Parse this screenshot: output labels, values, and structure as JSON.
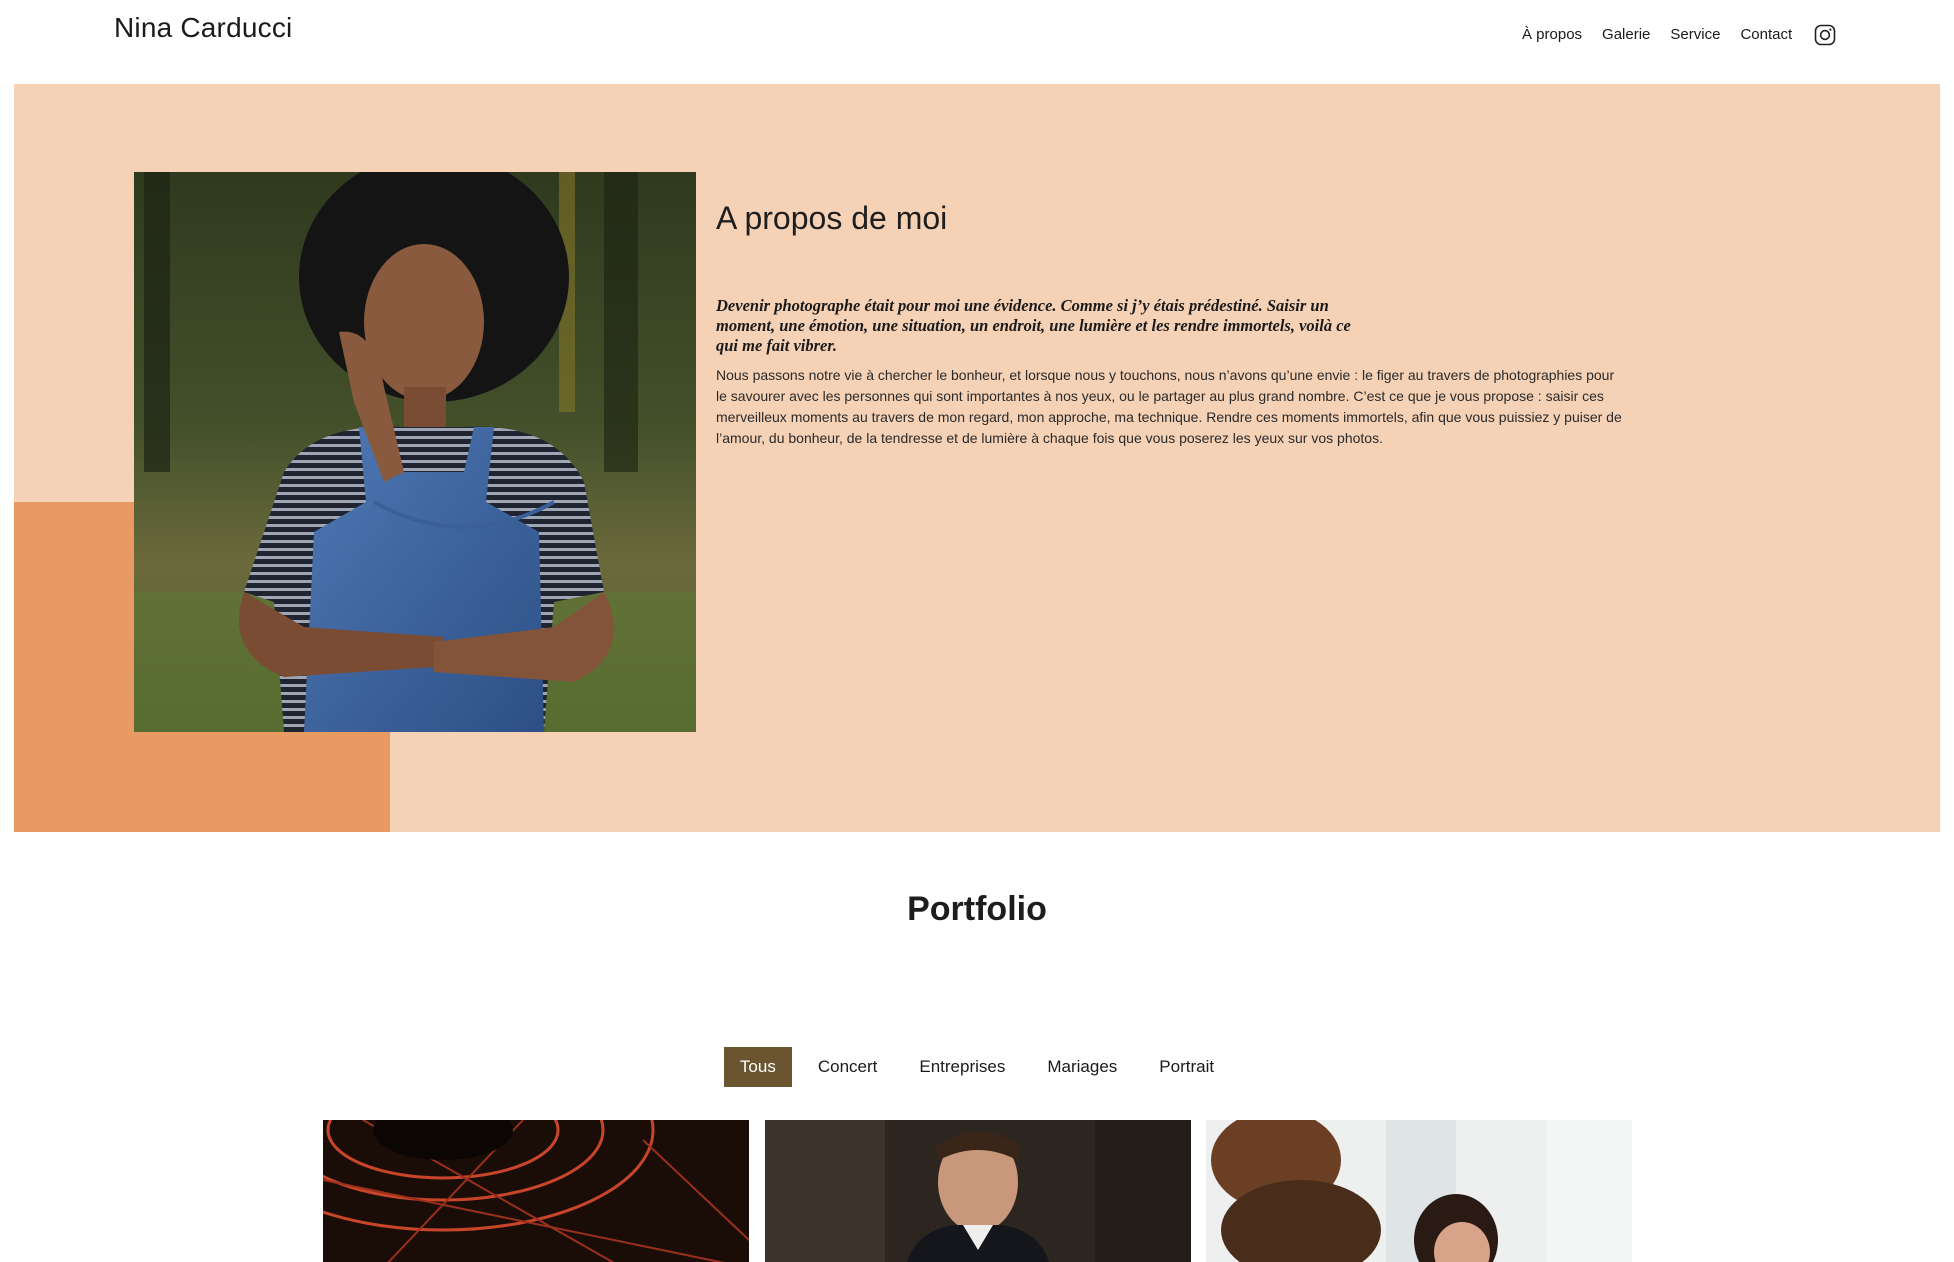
{
  "header": {
    "brand": "Nina Carducci",
    "nav": [
      {
        "label": "À propos"
      },
      {
        "label": "Galerie"
      },
      {
        "label": "Service"
      },
      {
        "label": "Contact"
      }
    ],
    "social_icon": "instagram-icon"
  },
  "about": {
    "title": "A propos de moi",
    "quote": "Devenir photographe était pour moi une évidence. Comme si j’y étais prédestiné. Saisir un moment, une émotion, une situation, un endroit, une lumière et les rendre immortels, voilà ce qui me fait vibrer.",
    "text": "Nous passons notre vie à chercher le bonheur, et lorsque nous y touchons, nous n’avons qu’une envie : le figer au travers de photographies pour le savourer avec les personnes qui sont importantes à nos yeux, ou le partager au plus grand nombre. C’est ce que je vous propose : saisir ces merveilleux moments au travers de mon regard, mon approche, ma technique. Rendre ces moments immortels, afin que vous puissiez y puiser de l’amour, du bonheur, de la tendresse et de lumière à chaque fois que vous poserez les yeux sur vos photos.",
    "colors": {
      "background": "#f5d1b6",
      "accent": "#e79b62"
    }
  },
  "portfolio": {
    "title": "Portfolio",
    "filters": [
      {
        "label": "Tous",
        "active": true
      },
      {
        "label": "Concert",
        "active": false
      },
      {
        "label": "Entreprises",
        "active": false
      },
      {
        "label": "Mariages",
        "active": false
      },
      {
        "label": "Portrait",
        "active": false
      }
    ],
    "active_color": "#6a5530"
  }
}
